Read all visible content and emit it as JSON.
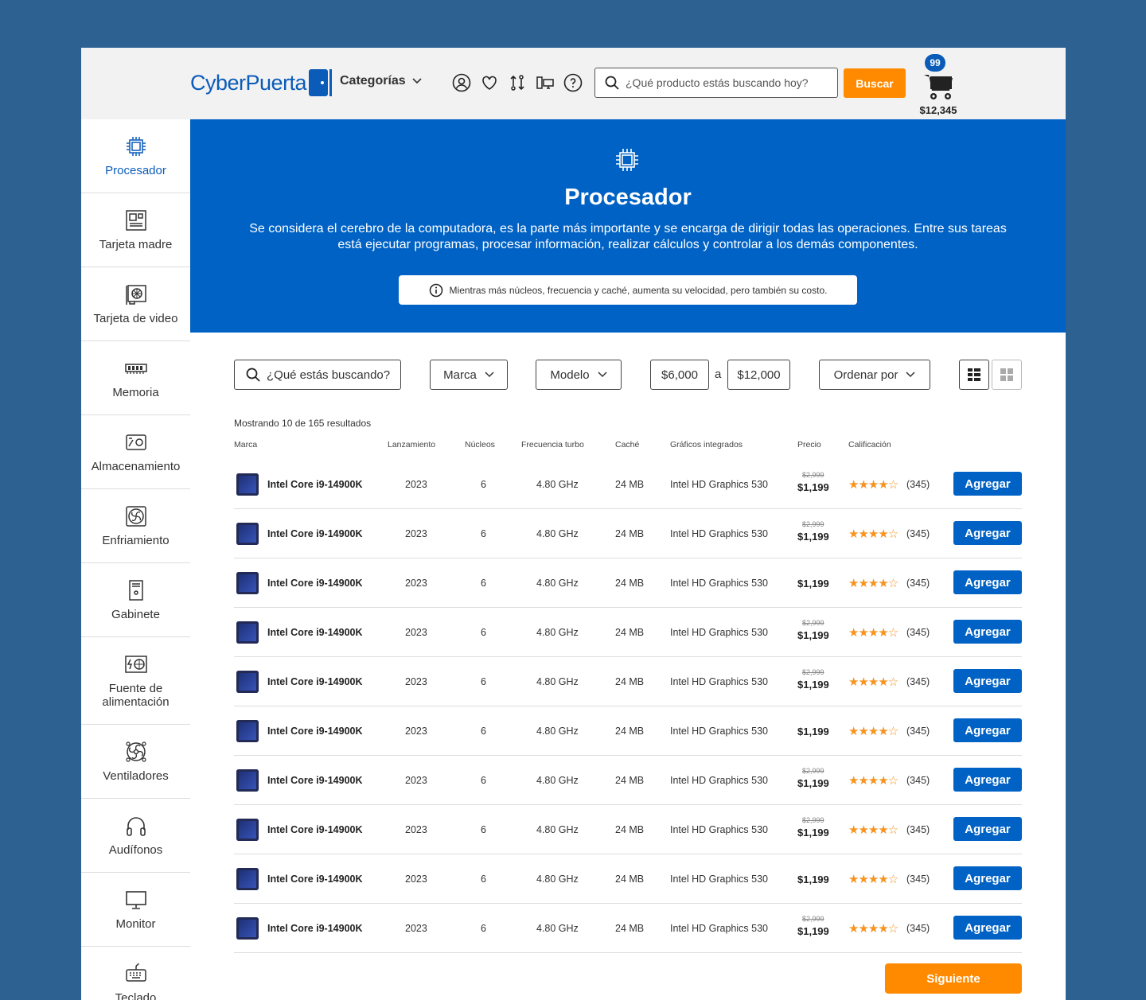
{
  "header": {
    "logo_text": "CyberPuerta",
    "categories_label": "Categorías",
    "icons": [
      "user-icon",
      "heart-icon",
      "compare-icon",
      "devices-icon",
      "help-icon"
    ],
    "search_placeholder": "¿Qué producto estás buscando hoy?",
    "search_button": "Buscar",
    "cart_count": "99",
    "cart_total": "$12,345"
  },
  "sidebar": {
    "items": [
      {
        "label": "Procesador",
        "icon": "cpu-icon",
        "active": true
      },
      {
        "label": "Tarjeta madre",
        "icon": "motherboard-icon"
      },
      {
        "label": "Tarjeta de video",
        "icon": "gpu-icon"
      },
      {
        "label": "Memoria",
        "icon": "ram-icon"
      },
      {
        "label": "Almacenamiento",
        "icon": "storage-icon"
      },
      {
        "label": "Enfriamiento",
        "icon": "cooling-icon"
      },
      {
        "label": "Gabinete",
        "icon": "case-icon"
      },
      {
        "label": "Fuente de alimentación",
        "icon": "psu-icon"
      },
      {
        "label": "Ventiladores",
        "icon": "fan-icon"
      },
      {
        "label": "Audífonos",
        "icon": "headphones-icon"
      },
      {
        "label": "Monitor",
        "icon": "monitor-icon"
      },
      {
        "label": "Teclado",
        "icon": "keyboard-icon"
      }
    ]
  },
  "hero": {
    "title": "Procesador",
    "description": "Se considera el cerebro de la computadora, es la parte más importante y se encarga de dirigir todas las operaciones. Entre sus tareas está ejecutar programas, procesar información, realizar cálculos y controlar a los demás componentes.",
    "hint": "Mientras más núcleos, frecuencia y caché, aumenta su velocidad, pero también su costo."
  },
  "filters": {
    "search_placeholder": "¿Qué estás buscando?",
    "brand": "Marca",
    "model": "Modelo",
    "price_min": "$6,000",
    "price_sep": "a",
    "price_max": "$12,000",
    "sort": "Ordenar por"
  },
  "results": {
    "count_text": "Mostrando 10 de 165 resultados",
    "columns": {
      "brand": "Marca",
      "year": "Lanzamiento",
      "cores": "Núcleos",
      "freq": "Frecuencia turbo",
      "cache": "Caché",
      "gfx": "Gráficos integrados",
      "price": "Precio",
      "rating": "Calificación"
    },
    "rows": [
      {
        "name": "Intel Core i9-14900K",
        "year": "2023",
        "cores": "6",
        "freq": "4.80 GHz",
        "cache": "24 MB",
        "gfx": "Intel HD Graphics 530",
        "old_price": "$2,999",
        "price": "$1,199",
        "stars": 4,
        "reviews": "(345)",
        "button": "Agregar"
      },
      {
        "name": "Intel Core i9-14900K",
        "year": "2023",
        "cores": "6",
        "freq": "4.80 GHz",
        "cache": "24 MB",
        "gfx": "Intel HD Graphics 530",
        "old_price": "$2,999",
        "price": "$1,199",
        "stars": 4,
        "reviews": "(345)",
        "button": "Agregar"
      },
      {
        "name": "Intel Core i9-14900K",
        "year": "2023",
        "cores": "6",
        "freq": "4.80 GHz",
        "cache": "24 MB",
        "gfx": "Intel HD Graphics 530",
        "old_price": "",
        "price": "$1,199",
        "stars": 4,
        "reviews": "(345)",
        "button": "Agregar"
      },
      {
        "name": "Intel Core i9-14900K",
        "year": "2023",
        "cores": "6",
        "freq": "4.80 GHz",
        "cache": "24 MB",
        "gfx": "Intel HD Graphics 530",
        "old_price": "$2,999",
        "price": "$1,199",
        "stars": 4,
        "reviews": "(345)",
        "button": "Agregar"
      },
      {
        "name": "Intel Core i9-14900K",
        "year": "2023",
        "cores": "6",
        "freq": "4.80 GHz",
        "cache": "24 MB",
        "gfx": "Intel HD Graphics 530",
        "old_price": "$2,999",
        "price": "$1,199",
        "stars": 4,
        "reviews": "(345)",
        "button": "Agregar"
      },
      {
        "name": "Intel Core i9-14900K",
        "year": "2023",
        "cores": "6",
        "freq": "4.80 GHz",
        "cache": "24 MB",
        "gfx": "Intel HD Graphics 530",
        "old_price": "",
        "price": "$1,199",
        "stars": 4,
        "reviews": "(345)",
        "button": "Agregar"
      },
      {
        "name": "Intel Core i9-14900K",
        "year": "2023",
        "cores": "6",
        "freq": "4.80 GHz",
        "cache": "24 MB",
        "gfx": "Intel HD Graphics 530",
        "old_price": "$2,999",
        "price": "$1,199",
        "stars": 4,
        "reviews": "(345)",
        "button": "Agregar"
      },
      {
        "name": "Intel Core i9-14900K",
        "year": "2023",
        "cores": "6",
        "freq": "4.80 GHz",
        "cache": "24 MB",
        "gfx": "Intel HD Graphics 530",
        "old_price": "$2,999",
        "price": "$1,199",
        "stars": 4,
        "reviews": "(345)",
        "button": "Agregar"
      },
      {
        "name": "Intel Core i9-14900K",
        "year": "2023",
        "cores": "6",
        "freq": "4.80 GHz",
        "cache": "24 MB",
        "gfx": "Intel HD Graphics 530",
        "old_price": "",
        "price": "$1,199",
        "stars": 4,
        "reviews": "(345)",
        "button": "Agregar"
      },
      {
        "name": "Intel Core i9-14900K",
        "year": "2023",
        "cores": "6",
        "freq": "4.80 GHz",
        "cache": "24 MB",
        "gfx": "Intel HD Graphics 530",
        "old_price": "$2,999",
        "price": "$1,199",
        "stars": 4,
        "reviews": "(345)",
        "button": "Agregar"
      }
    ],
    "next_button": "Siguiente"
  },
  "colors": {
    "brand_blue": "#0062c4",
    "accent_orange": "#ff8a00",
    "star": "#f7931e",
    "background": "#2c6192"
  }
}
